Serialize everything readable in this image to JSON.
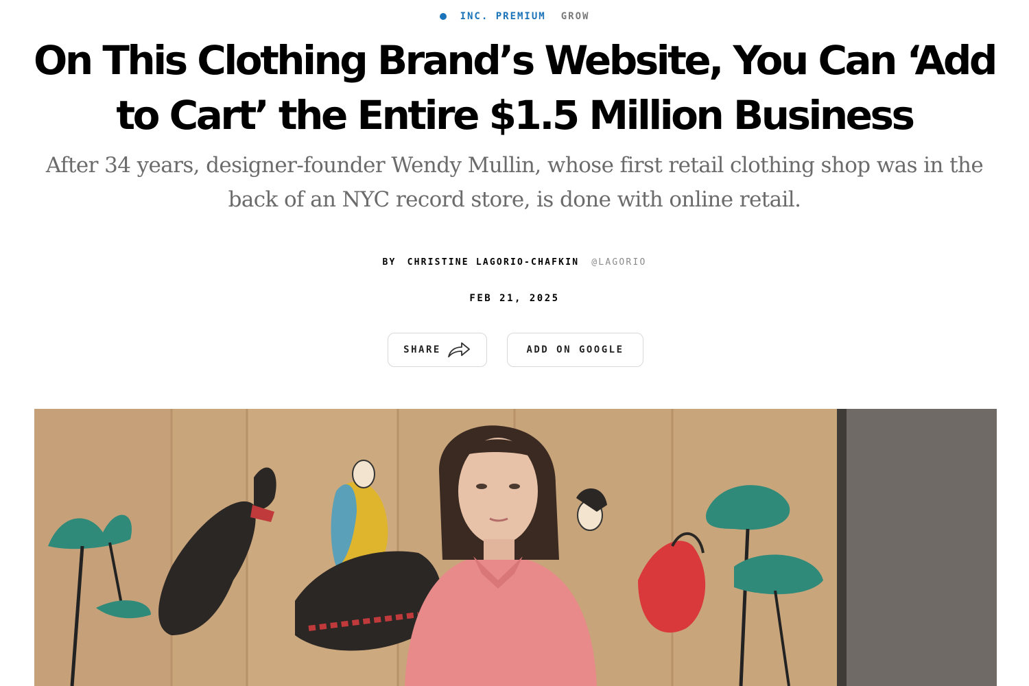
{
  "kicker": {
    "premium_label": "INC. PREMIUM",
    "section_label": "GROW",
    "accent_color": "#1a73b8"
  },
  "article": {
    "headline_line1": "On This Clothing Brand’s Website, You Can ‘Add",
    "headline_line2": "to Cart’ the Entire $1.5 Million Business",
    "dek": "After 34 years, designer-founder Wendy Mullin, whose first retail clothing shop was in the back of an NYC record store, is done with online retail.",
    "byline_prefix": "BY",
    "author": "CHRISTINE LAGORIO-CHAFKIN",
    "handle": "@LAGORIO",
    "date": "FEB 21, 2025"
  },
  "actions": {
    "share_label": "SHARE",
    "share_icon": "share-arrow-icon",
    "google_label": "ADD ON GOOGLE"
  },
  "hero_image": {
    "description_colors": {
      "screen": "#c9a57c",
      "wall": "#6f6a65",
      "shirt": "#e88a8a"
    }
  }
}
